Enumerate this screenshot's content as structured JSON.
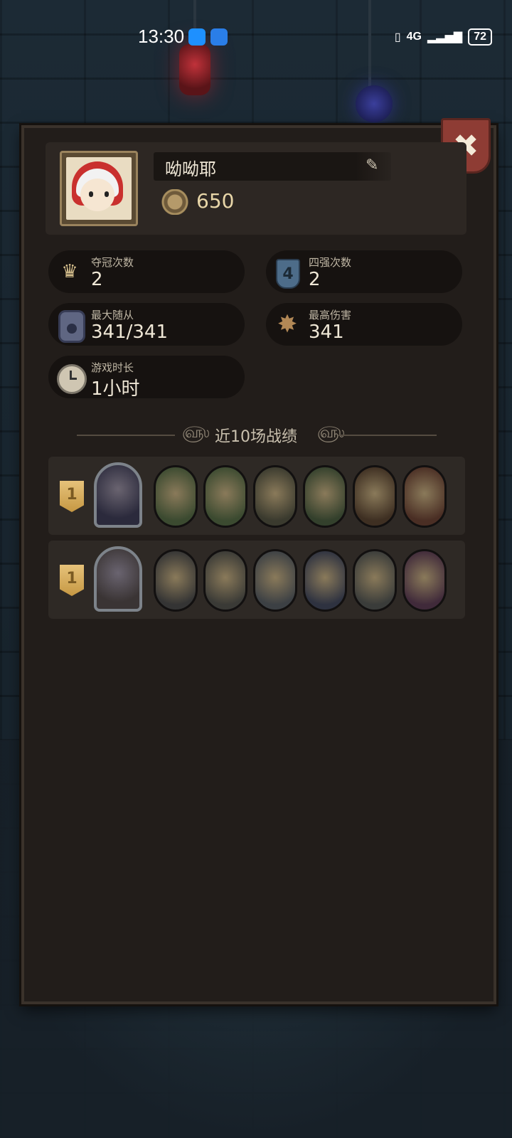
{
  "status_bar": {
    "time": "13:30",
    "network": "4G",
    "battery": "72"
  },
  "profile": {
    "name": "呦呦耶",
    "coins": "650"
  },
  "stats": [
    {
      "label": "夺冠次数",
      "value": "2",
      "icon": "crown-icon"
    },
    {
      "label": "四强次数",
      "value": "2",
      "icon": "shield-four-icon"
    },
    {
      "label": "最大随从",
      "value": "341/341",
      "icon": "minion-icon"
    },
    {
      "label": "最高伤害",
      "value": "341",
      "icon": "damage-burst-icon"
    },
    {
      "label": "游戏时长",
      "value": "1小时",
      "icon": "clock-icon"
    }
  ],
  "shield_number": "4",
  "section_title": "近10场战绩",
  "matches": [
    {
      "rank": "1",
      "hero": {
        "name": "hooded-reaper",
        "color": "#2b2a3c"
      },
      "minions": [
        {
          "name": "pinocchio",
          "color": "#3b4a30"
        },
        {
          "name": "pinocchio",
          "color": "#3b4a30"
        },
        {
          "name": "mushroom-goblin",
          "color": "#3a3a2e"
        },
        {
          "name": "leaf-sprite",
          "color": "#33402c"
        },
        {
          "name": "tree-golem",
          "color": "#3e2f22"
        },
        {
          "name": "ogre-cook",
          "color": "#4a2e24"
        }
      ]
    },
    {
      "rank": "1",
      "hero": {
        "name": "gnome-elder",
        "color": "#3a3434"
      },
      "minions": [
        {
          "name": "iron-robot",
          "color": "#343434"
        },
        {
          "name": "rocket-launcher",
          "color": "#3a3a36"
        },
        {
          "name": "steel-turret",
          "color": "#3c4044"
        },
        {
          "name": "tentacle-worm",
          "color": "#2e3240"
        },
        {
          "name": "knight-rider",
          "color": "#3a3c3a"
        },
        {
          "name": "jester-clown",
          "color": "#402a3a"
        }
      ]
    }
  ],
  "colors": {
    "panel": "#221d1a",
    "pill": "#161210",
    "row": "#2e2925",
    "gold": "#d9c28f",
    "close": "#8e3c34"
  }
}
